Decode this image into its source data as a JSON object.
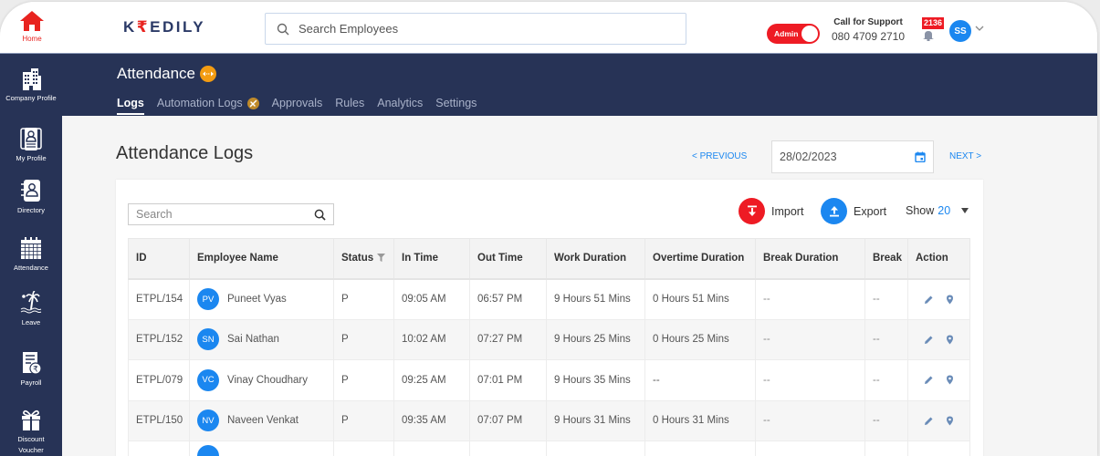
{
  "header": {
    "home_label": "Home",
    "logo_text_pre": "K",
    "logo_rupee": "₹",
    "logo_text_post": "EDILY",
    "search_placeholder": "Search Employees",
    "admin_toggle_label": "Admin",
    "support_title": "Call for Support",
    "support_phone": "080 4709 2710",
    "notification_count": "2136",
    "user_initials": "SS"
  },
  "module": {
    "title": "Attendance",
    "tabs": [
      {
        "label": "Logs",
        "active": true
      },
      {
        "label": "Automation Logs",
        "active": false
      },
      {
        "label": "Approvals",
        "active": false
      },
      {
        "label": "Rules",
        "active": false
      },
      {
        "label": "Analytics",
        "active": false
      },
      {
        "label": "Settings",
        "active": false
      }
    ]
  },
  "sidebar": {
    "items": [
      {
        "label": "Company Profile",
        "icon": "building-icon"
      },
      {
        "label": "My Profile",
        "icon": "profile-card-icon"
      },
      {
        "label": "Directory",
        "icon": "directory-book-icon"
      },
      {
        "label": "Attendance",
        "icon": "calendar-grid-icon"
      },
      {
        "label": "Leave",
        "icon": "palm-tree-icon"
      },
      {
        "label": "Payroll",
        "icon": "payroll-rupee-icon"
      },
      {
        "label": "Discount",
        "label2": "Voucher",
        "icon": "gift-icon"
      }
    ]
  },
  "page": {
    "title": "Attendance Logs",
    "prev_label": "< PREVIOUS",
    "next_label": "NEXT >",
    "date_value": "28/02/2023",
    "search_placeholder": "Search",
    "import_label": "Import",
    "export_label": "Export",
    "show_label": "Show",
    "show_value": "20"
  },
  "table": {
    "columns": [
      "ID",
      "Employee Name",
      "Status",
      "In Time",
      "Out Time",
      "Work Duration",
      "Overtime Duration",
      "Break Duration",
      "Break",
      "Action"
    ],
    "rows": [
      {
        "id": "ETPL/154",
        "initials": "PV",
        "name": "Puneet Vyas",
        "status": "P",
        "in_time": "09:05 AM",
        "out_time": "06:57 PM",
        "work": "9 Hours 51 Mins",
        "overtime": "0 Hours 51 Mins",
        "break_duration": "--",
        "break": "--"
      },
      {
        "id": "ETPL/152",
        "initials": "SN",
        "name": "Sai Nathan",
        "status": "P",
        "in_time": "10:02 AM",
        "out_time": "07:27 PM",
        "work": "9 Hours 25 Mins",
        "overtime": "0 Hours 25 Mins",
        "break_duration": "--",
        "break": "--"
      },
      {
        "id": "ETPL/079",
        "initials": "VC",
        "name": "Vinay Choudhary",
        "status": "P",
        "in_time": "09:25 AM",
        "out_time": "07:01 PM",
        "work": "9 Hours 35 Mins",
        "overtime": "--",
        "break_duration": "--",
        "break": "--"
      },
      {
        "id": "ETPL/150",
        "initials": "NV",
        "name": "Naveen Venkat",
        "status": "P",
        "in_time": "09:35 AM",
        "out_time": "07:07 PM",
        "work": "9 Hours 31 Mins",
        "overtime": "0 Hours 31 Mins",
        "break_duration": "--",
        "break": "--"
      }
    ]
  },
  "colors": {
    "brand_navy": "#273356",
    "accent_red": "#ee1b24",
    "accent_blue": "#1b87f0",
    "orange": "#f39c12"
  }
}
